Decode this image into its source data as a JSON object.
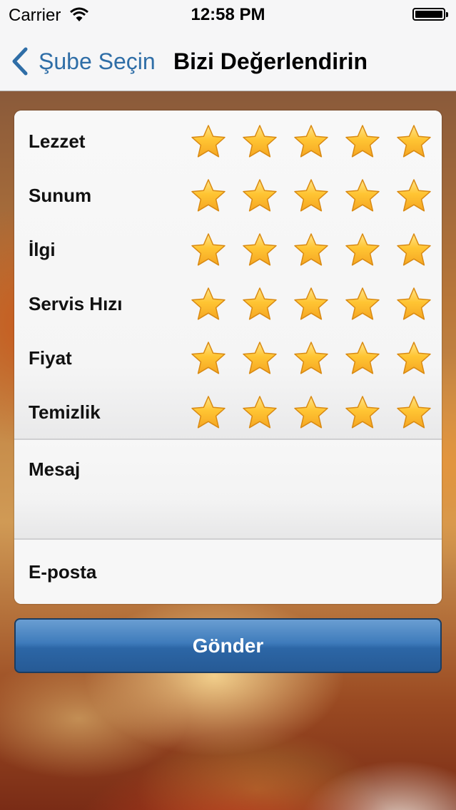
{
  "status_bar": {
    "carrier": "Carrier",
    "time": "12:58 PM"
  },
  "nav": {
    "back_label": "Şube Seçin",
    "title": "Bizi Değerlendirin"
  },
  "ratings": {
    "max_stars": 5,
    "star_color": "#f5a623",
    "items": [
      {
        "label": "Lezzet",
        "value": 5
      },
      {
        "label": "Sunum",
        "value": 5
      },
      {
        "label": "İlgi",
        "value": 5
      },
      {
        "label": "Servis Hızı",
        "value": 5
      },
      {
        "label": "Fiyat",
        "value": 5
      },
      {
        "label": "Temizlik",
        "value": 5
      }
    ]
  },
  "form": {
    "message_label": "Mesaj",
    "email_label": "E-posta"
  },
  "submit": {
    "label": "Gönder",
    "color": "#2c66a6"
  }
}
